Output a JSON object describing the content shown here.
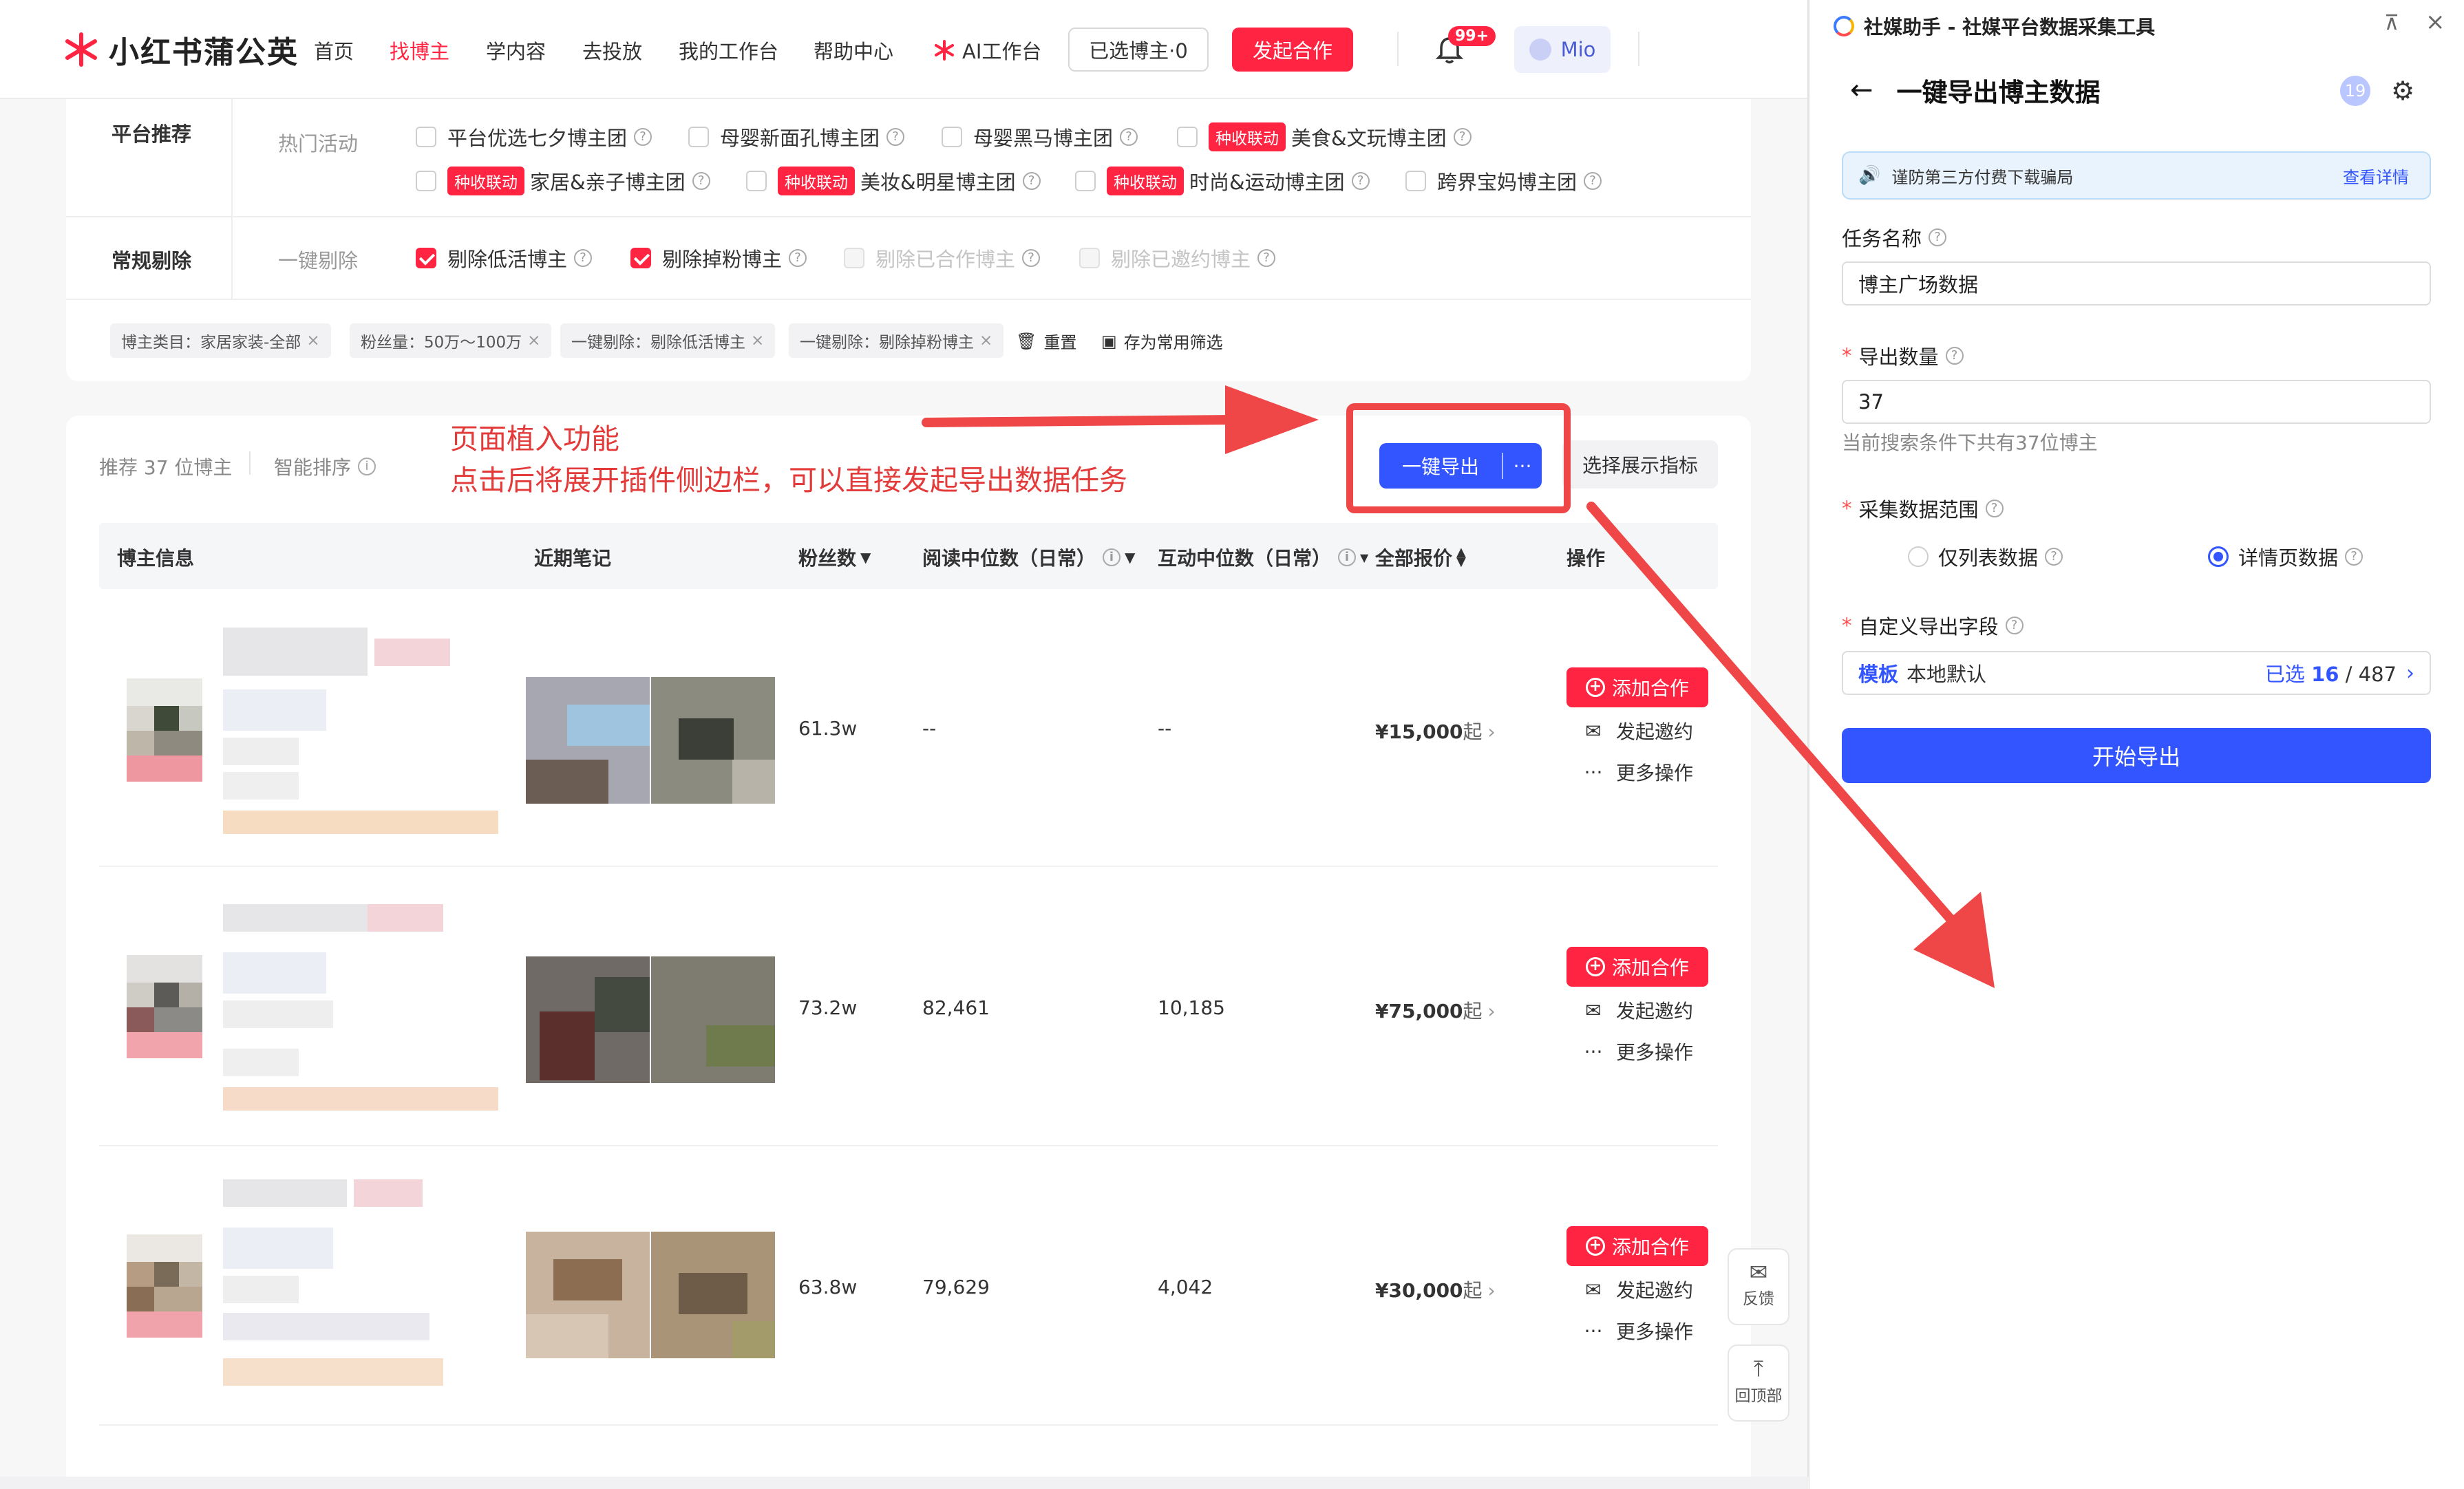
{
  "app": {
    "logo_text": "小红书蒲公英",
    "nav": [
      "首页",
      "找博主",
      "学内容",
      "去投放",
      "我的工作台",
      "帮助中心",
      "AI工作台"
    ],
    "nav_active_index": 1,
    "selected_btn": "已选博主·0",
    "cta_btn": "发起合作",
    "notif_badge": "99+",
    "user_name": "Mio"
  },
  "filters": {
    "platform_label": "平台推荐",
    "hot_label": "热门活动",
    "platform_items": [
      {
        "text": "平台优选七夕博主团",
        "tag": ""
      },
      {
        "text": "母婴新面孔博主团",
        "tag": ""
      },
      {
        "text": "母婴黑马博主团",
        "tag": ""
      },
      {
        "text": "美食&文玩博主团",
        "tag": "种收联动"
      },
      {
        "text": "家居&亲子博主团",
        "tag": "种收联动"
      },
      {
        "text": "美妆&明星博主团",
        "tag": "种收联动"
      },
      {
        "text": "时尚&运动博主团",
        "tag": "种收联动"
      },
      {
        "text": "跨界宝妈博主团",
        "tag": ""
      }
    ],
    "remove_label": "常规剔除",
    "remove_sub": "一键剔除",
    "remove_items": [
      {
        "text": "剔除低活博主",
        "checked": true,
        "disabled": false
      },
      {
        "text": "剔除掉粉博主",
        "checked": true,
        "disabled": false
      },
      {
        "text": "剔除已合作博主",
        "checked": false,
        "disabled": true
      },
      {
        "text": "剔除已邀约博主",
        "checked": false,
        "disabled": true
      }
    ],
    "active_tags": [
      "博主类目：家居家装-全部",
      "粉丝量：50万～100万",
      "一键剔除：剔除低活博主",
      "一键剔除：剔除掉粉博主"
    ],
    "reset_label": "重置",
    "save_label": "存为常用筛选"
  },
  "results": {
    "count_text": "推荐 37 位博主",
    "sort_text": "智能排序",
    "export_btn": "一键导出",
    "export_more": "···",
    "metrics_btn": "选择展示指标",
    "headers": [
      "博主信息",
      "近期笔记",
      "粉丝数",
      "阅读中位数（日常）",
      "互动中位数（日常）",
      "全部报价",
      "操作"
    ],
    "rows": [
      {
        "fans": "61.3w",
        "read": "--",
        "interact": "--",
        "price": "¥15,000",
        "price_suffix": "起"
      },
      {
        "fans": "73.2w",
        "read": "82,461",
        "interact": "10,185",
        "price": "¥75,000",
        "price_suffix": "起"
      },
      {
        "fans": "63.8w",
        "read": "79,629",
        "interact": "4,042",
        "price": "¥30,000",
        "price_suffix": "起"
      }
    ],
    "action_add": "添加合作",
    "action_invite": "发起邀约",
    "action_more": "更多操作"
  },
  "floating": {
    "feedback": "反馈",
    "top": "回顶部"
  },
  "annotation": {
    "line1": "页面植入功能",
    "line2": "点击后将展开插件侧边栏，可以直接发起导出数据任务",
    "color": "#ef4747"
  },
  "plugin": {
    "window_title": "社媒助手 - 社媒平台数据采集工具",
    "header": "一键导出博主数据",
    "count_badge": "19",
    "notice_text": "谨防第三方付费下载骗局",
    "notice_link": "查看详情",
    "task_name_label": "任务名称",
    "task_name_value": "博主广场数据",
    "export_count_label": "导出数量",
    "export_count_value": "37",
    "export_hint": "当前搜索条件下共有37位博主",
    "scope_label": "采集数据范围",
    "scope_options": [
      {
        "text": "仅列表数据",
        "selected": false
      },
      {
        "text": "详情页数据",
        "selected": true
      }
    ],
    "fields_label": "自定义导出字段",
    "tpl_key": "模板",
    "tpl_value": "本地默认",
    "selected_prefix": "已选",
    "selected_count": "16",
    "total_count": "487",
    "start_btn": "开始导出",
    "accent": "#3355ff"
  },
  "colors": {
    "brand": "#ff2442",
    "accent": "#3355ff"
  }
}
